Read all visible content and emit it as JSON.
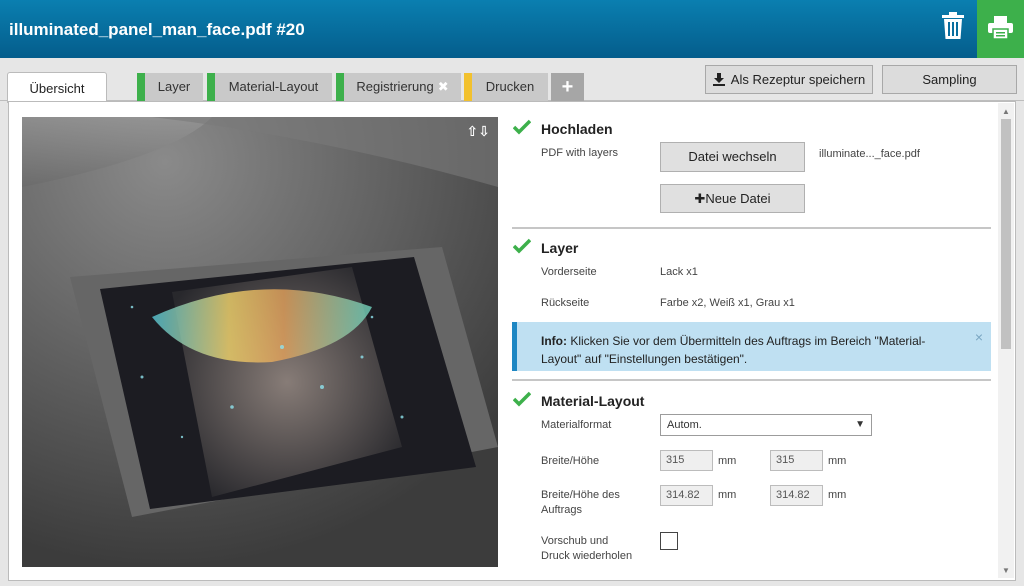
{
  "header": {
    "title": "illuminated_panel_man_face.pdf #20",
    "trash_icon": "trash-icon",
    "print_icon": "printer-icon",
    "accent": "#3db04b"
  },
  "tabs": {
    "overview": "Übersicht",
    "layer": "Layer",
    "material_layout": "Material-Layout",
    "registration": "Registrierung",
    "registration_x": "✖",
    "print": "Drucken",
    "plus": "+"
  },
  "actions": {
    "save_recipe": "Als Rezeptur speichern",
    "sampling": "Sampling"
  },
  "preview": {
    "arrows": "⇧⇩"
  },
  "upload": {
    "title": "Hochladen",
    "label": "PDF with layers",
    "change_file": "Datei wechseln",
    "file_name": "illuminate..._face.pdf",
    "new_file": "Neue Datei"
  },
  "layer": {
    "title": "Layer",
    "front_label": "Vorderseite",
    "front_value": "Lack x1",
    "back_label": "Rückseite",
    "back_value": "Farbe x2, Weiß x1, Grau x1"
  },
  "info": {
    "bold": "Info:",
    "text": "Klicken Sie vor dem Übermitteln des Auftrags im Bereich \"Material-Layout\" auf \"Einstellungen bestätigen\".",
    "close": "×"
  },
  "material": {
    "title": "Material-Layout",
    "format_label": "Materialformat",
    "format_value": "Autom.",
    "wh_label": "Breite/Höhe",
    "width": "315",
    "height": "315",
    "unit": "mm",
    "job_label_1": "Breite/Höhe des",
    "job_label_2": "Auftrags",
    "job_width": "314.82",
    "job_height": "314.82",
    "repeat_label_1": "Vorschub und",
    "repeat_label_2": "Druck wiederholen"
  }
}
